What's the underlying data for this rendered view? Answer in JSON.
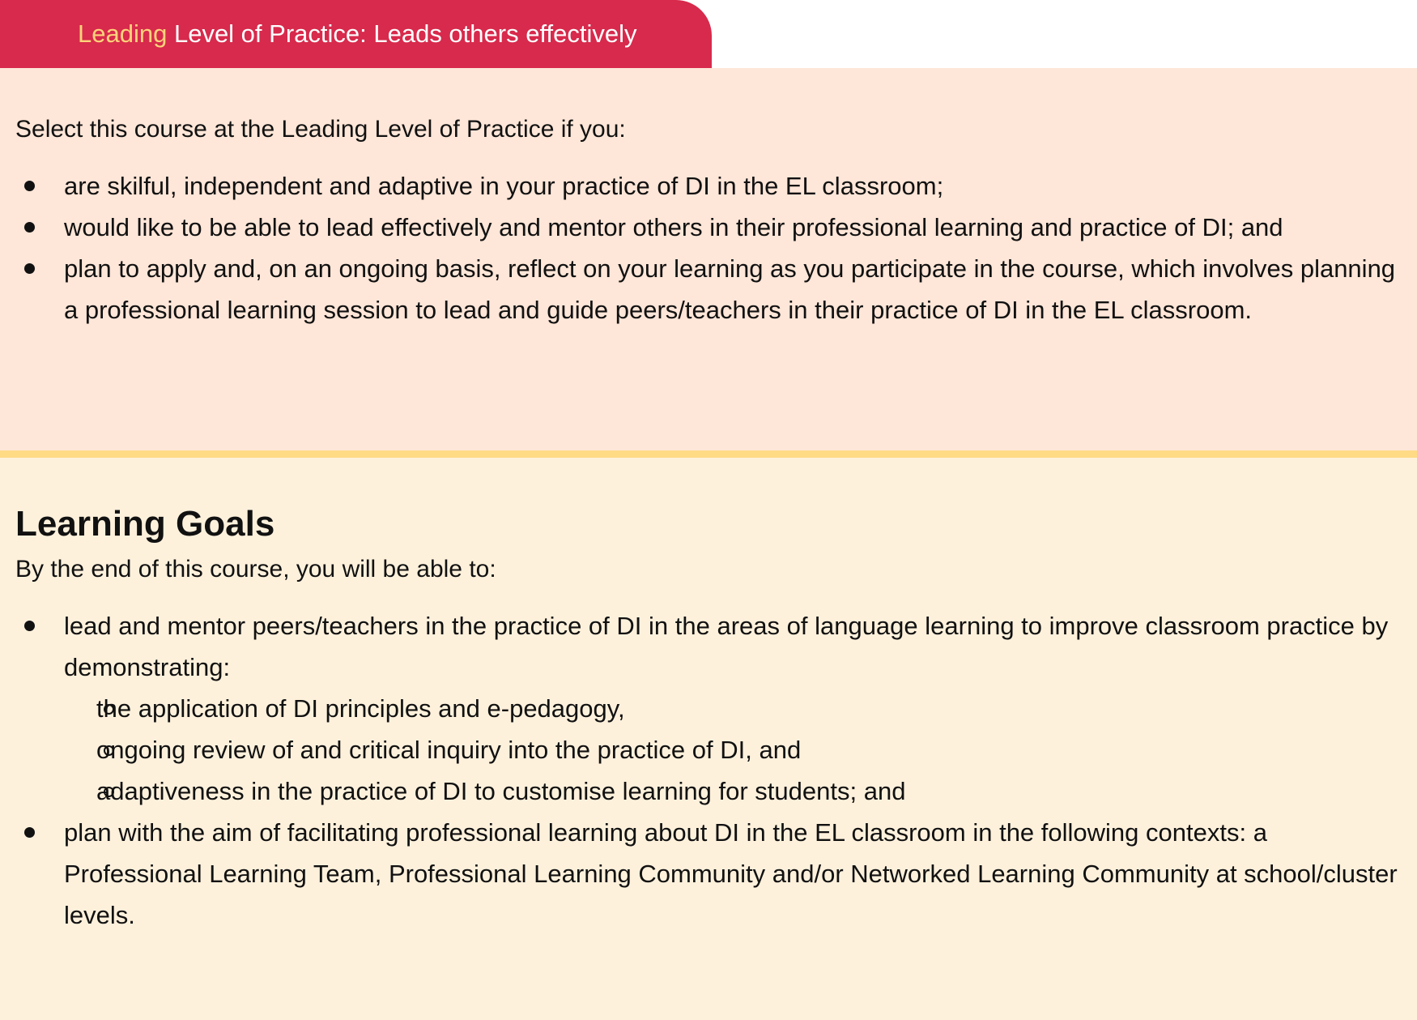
{
  "tab": {
    "highlight": "Leading",
    "rest": " Level of Practice: Leads others effectively",
    "colors": {
      "background": "#d72a4c",
      "highlight_text": "#ffd37a",
      "text": "#ffffff"
    }
  },
  "practice": {
    "intro": "Select this course at the Leading Level of Practice if you:",
    "items": [
      "are skilful, independent and adaptive in your practice of DI in the EL classroom;",
      "would like to be able to lead effectively and mentor others in their professional learning and practice of DI; and",
      "plan to apply and, on an ongoing basis, reflect on your learning as you participate in the course, which involves planning a professional learning session to lead and guide peers/teachers in their practice of DI in the EL classroom."
    ],
    "background_color": "#fee6d8"
  },
  "divider_color": "#ffdb85",
  "goals": {
    "heading": "Learning Goals",
    "intro": "By the end of this course, you will be able to:",
    "items": [
      {
        "text": "lead and mentor peers/teachers in the practice of DI in the areas of language learning to improve classroom practice by demonstrating:",
        "subitems": [
          "the application of DI principles and e-pedagogy,",
          "ongoing review of and critical inquiry into the practice of DI, and",
          "adaptiveness in the practice of DI to customise learning for students; and"
        ]
      },
      {
        "text": "plan with the aim of facilitating professional learning about DI in the EL classroom in the following contexts: a Professional Learning Team, Professional Learning Community and/or Networked Learning Community at school/cluster levels."
      }
    ],
    "background_color": "#fef1dc"
  }
}
